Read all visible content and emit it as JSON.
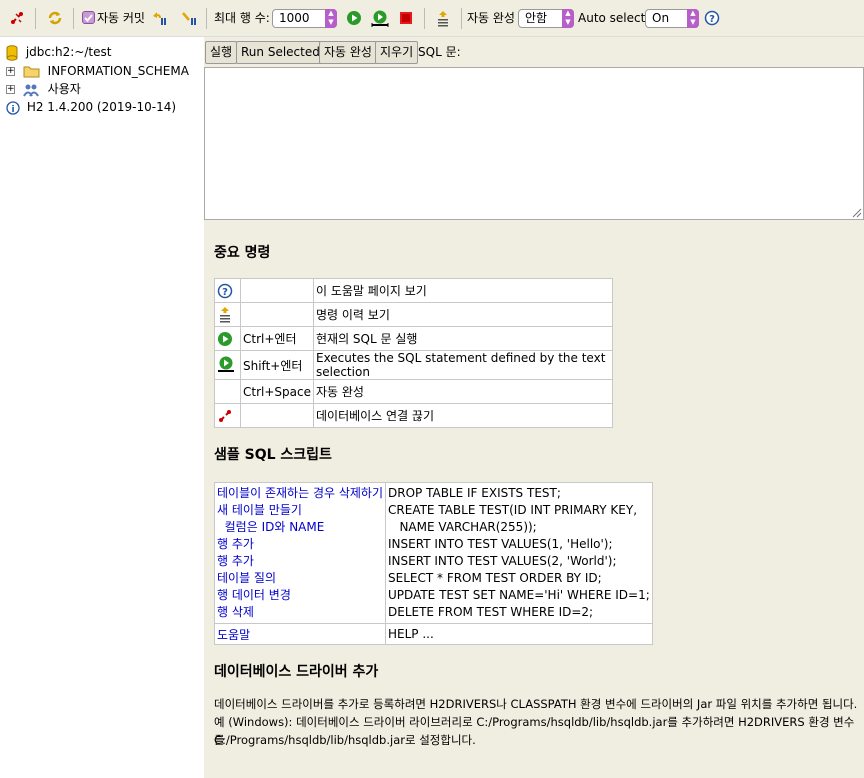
{
  "toolbar": {
    "auto_commit_label": "자동 커밋",
    "max_rows_label": "최대 행 수:",
    "max_rows_value": "1000",
    "autocomplete_label": "자동 완성",
    "autocomplete_value": "안함",
    "auto_select_label": "Auto select",
    "auto_select_value": "On"
  },
  "tree": {
    "connection": "jdbc:h2:~/test",
    "schema": "INFORMATION_SCHEMA",
    "users": "사용자",
    "version": "H2 1.4.200 (2019-10-14)"
  },
  "query": {
    "run": "실행",
    "run_selected": "Run Selected",
    "autocomplete": "자동 완성",
    "clear": "지우기",
    "sql_label": "SQL 문:"
  },
  "help": {
    "important_title": "중요 명령",
    "commands": [
      {
        "key": "",
        "desc": "이 도움말 페이지 보기"
      },
      {
        "key": "",
        "desc": "명령 이력 보기"
      },
      {
        "key": "Ctrl+엔터",
        "desc": "현재의 SQL 문 실행"
      },
      {
        "key": "Shift+엔터",
        "desc": "Executes the SQL statement defined by the text selection"
      },
      {
        "key": "Ctrl+Space",
        "desc": "자동 완성"
      },
      {
        "key": "",
        "desc": "데이터베이스 연결 끊기"
      }
    ],
    "sample_title": "샘플 SQL 스크립트",
    "samples": [
      {
        "label": "테이블이 존재하는 경우 삭제하기",
        "sql": "DROP TABLE IF EXISTS TEST;"
      },
      {
        "label": "새 테이블 만들기",
        "sql": "CREATE TABLE TEST(ID INT PRIMARY KEY,"
      },
      {
        "label": "  컬럼은 ID와 NAME",
        "sql": "   NAME VARCHAR(255));"
      },
      {
        "label": "행 추가",
        "sql": "INSERT INTO TEST VALUES(1, 'Hello');"
      },
      {
        "label": "행 추가",
        "sql": "INSERT INTO TEST VALUES(2, 'World');"
      },
      {
        "label": "테이블 질의",
        "sql": "SELECT * FROM TEST ORDER BY ID;"
      },
      {
        "label": "행 데이터 변경",
        "sql": "UPDATE TEST SET NAME='Hi' WHERE ID=1;"
      },
      {
        "label": "행 삭제",
        "sql": "DELETE FROM TEST WHERE ID=2;"
      }
    ],
    "help_label": "도움말",
    "help_sql": "HELP ...",
    "driver_title": "데이터베이스 드라이버 추가",
    "driver_line1": "데이터베이스 드라이버를 추가로 등록하려면 H2DRIVERS나 CLASSPATH 환경 변수에 드라이버의 Jar 파일 위치를 추가하면 됩니다.",
    "driver_line2": "예 (Windows): 데이터베이스 드라이버 라이브러리로 C:/Programs/hsqldb/lib/hsqldb.jar를 추가하려면 H2DRIVERS 환경 변수를",
    "driver_line3": "C:/Programs/hsqldb/lib/hsqldb.jar로 설정합니다."
  }
}
